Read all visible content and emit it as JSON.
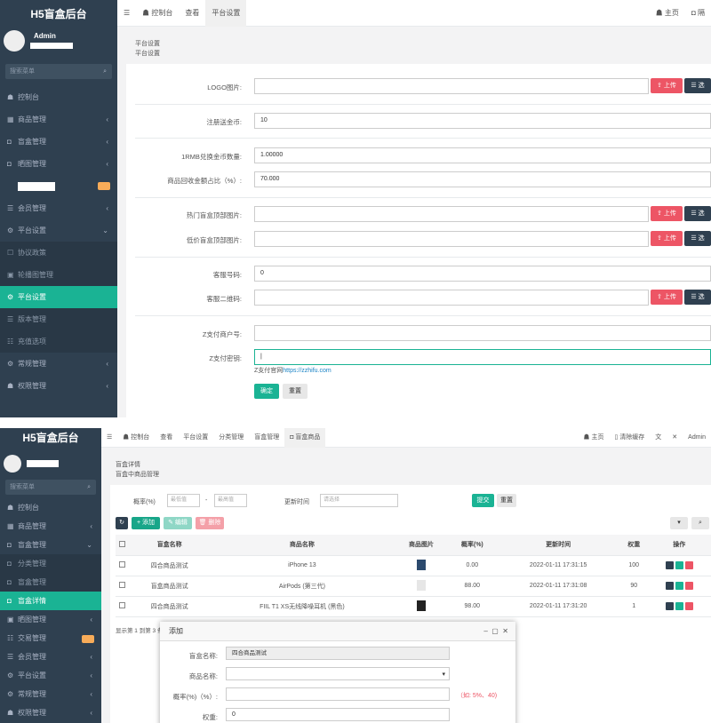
{
  "s1": {
    "brand": "H5盲盒后台",
    "user": "Admin",
    "search_placeholder": "搜索菜单",
    "menu": [
      {
        "icon": "☗",
        "label": "控制台",
        "arrow": "",
        "state": ""
      },
      {
        "icon": "▦",
        "label": "商品管理",
        "arrow": "‹",
        "state": ""
      },
      {
        "icon": "◘",
        "label": "盲盒管理",
        "arrow": "‹",
        "state": ""
      },
      {
        "icon": "◘",
        "label": "晒图管理",
        "arrow": "‹",
        "state": ""
      },
      {
        "icon": "",
        "label": "",
        "arrow": "",
        "state": "hidden"
      },
      {
        "icon": "☰",
        "label": "会员管理",
        "arrow": "‹",
        "state": ""
      },
      {
        "icon": "⚙",
        "label": "平台设置",
        "arrow": "⌄",
        "state": ""
      },
      {
        "icon": "☐",
        "label": "协议政策",
        "arrow": "",
        "state": "sub"
      },
      {
        "icon": "▣",
        "label": "轮播图管理",
        "arrow": "",
        "state": "sub"
      },
      {
        "icon": "⚙",
        "label": "平台设置",
        "arrow": "",
        "state": "act"
      },
      {
        "icon": "☰",
        "label": "版本管理",
        "arrow": "",
        "state": "sub"
      },
      {
        "icon": "☷",
        "label": "充值选项",
        "arrow": "",
        "state": "sub"
      },
      {
        "icon": "⚙",
        "label": "常规管理",
        "arrow": "‹",
        "state": ""
      },
      {
        "icon": "☗",
        "label": "权限管理",
        "arrow": "‹",
        "state": ""
      }
    ],
    "tabs": [
      "☰",
      "☗ 控制台",
      "查看",
      "平台设置"
    ],
    "top_right": [
      "☗ 主页",
      "◘ 隔"
    ],
    "panel_title": "平台设置",
    "panel_sub": "平台设置",
    "fields": {
      "logo": "LOGO图片:",
      "gift": "注册送金币:",
      "gift_val": "10",
      "rate": "1RMB兑换金币数量:",
      "rate_val": "1.00000",
      "recycle": "商品回收金额占比（%）:",
      "recycle_val": "70.000",
      "hot": "热门盲盒顶部图片:",
      "low": "低价盲盒顶部图片:",
      "kf": "客服号码:",
      "kf_val": "0",
      "qr": "客服二维码:",
      "zpid": "Z支付商户号:",
      "zkey": "Z支付密钥:",
      "site_label": "Z支付官网",
      "site_url": "https://zzhifu.com"
    },
    "upload": "上传",
    "choose": "选",
    "submit": "确定",
    "reset": "重置"
  },
  "s2": {
    "brand": "H5盲盒后台",
    "search_placeholder": "搜索菜单",
    "menu": [
      {
        "icon": "☗",
        "label": "控制台",
        "arrow": "",
        "state": ""
      },
      {
        "icon": "▦",
        "label": "商品管理",
        "arrow": "‹",
        "state": ""
      },
      {
        "icon": "◘",
        "label": "盲盒管理",
        "arrow": "⌄",
        "state": ""
      },
      {
        "icon": "◘",
        "label": "分类管理",
        "arrow": "",
        "state": "sub"
      },
      {
        "icon": "◘",
        "label": "盲盒管理",
        "arrow": "",
        "state": "sub"
      },
      {
        "icon": "◘",
        "label": "盲盒详情",
        "arrow": "",
        "state": "act"
      },
      {
        "icon": "▣",
        "label": "晒图管理",
        "arrow": "‹",
        "state": ""
      },
      {
        "icon": "☷",
        "label": "交易管理",
        "arrow": "",
        "state": "badge"
      },
      {
        "icon": "☰",
        "label": "会员管理",
        "arrow": "‹",
        "state": ""
      },
      {
        "icon": "⚙",
        "label": "平台设置",
        "arrow": "‹",
        "state": ""
      },
      {
        "icon": "⚙",
        "label": "常规管理",
        "arrow": "‹",
        "state": ""
      },
      {
        "icon": "☗",
        "label": "权限管理",
        "arrow": "‹",
        "state": ""
      }
    ],
    "tabs": [
      "☰",
      "☗ 控制台",
      "查看",
      "平台设置",
      "分类管理",
      "盲盒管理",
      "◘ 盲盒商品"
    ],
    "top_right": [
      "☗ 主页",
      "▯ 清除缓存",
      "文",
      "✕",
      "Admin"
    ],
    "panel_title": "盲盒详情",
    "panel_sub": "盲盒中商品管理",
    "filter": {
      "odds": "概率(%)",
      "from": "最低值",
      "to": "最高值",
      "dash": "-",
      "time": "更新时间",
      "time_ph": "请选择",
      "submit": "提交",
      "reset": "重置"
    },
    "toolbar": {
      "refresh": "↻",
      "add": "+ 添加",
      "edit": "✎ 编辑",
      "del": "🗑 删除"
    },
    "columns": [
      "",
      "盲盒名称",
      "商品名称",
      "商品图片",
      "概率(%)",
      "更新时间",
      "权重",
      "操作"
    ],
    "rows": [
      {
        "box": "四合商品测试",
        "product": "iPhone 13",
        "odds": "0.00",
        "time": "2022-01-11 17:31:15",
        "weight": "100"
      },
      {
        "box": "盲盒商品测试",
        "product": "AirPods (第三代)",
        "odds": "88.00",
        "time": "2022-01-11 17:31:08",
        "weight": "90"
      },
      {
        "box": "四合商品测试",
        "product": "FIIL T1 XS无线降噪耳机 (黑色)",
        "odds": "98.00",
        "time": "2022-01-11 17:31:20",
        "weight": "1"
      }
    ],
    "footer": "显示第 1 到第 3 条",
    "modal": {
      "title": "添加",
      "box_label": "盲盒名称:",
      "box_val": "四合商品测试",
      "prod_label": "商品名称:",
      "odds_label": "概率(%)（%）:",
      "odds_hint": "（如: 5%、40)",
      "weight_label": "权重:",
      "weight_val": "0"
    }
  },
  "colors": {
    "sidebar": "#2f4050",
    "accent": "#1ab394",
    "danger": "#ed5565"
  }
}
